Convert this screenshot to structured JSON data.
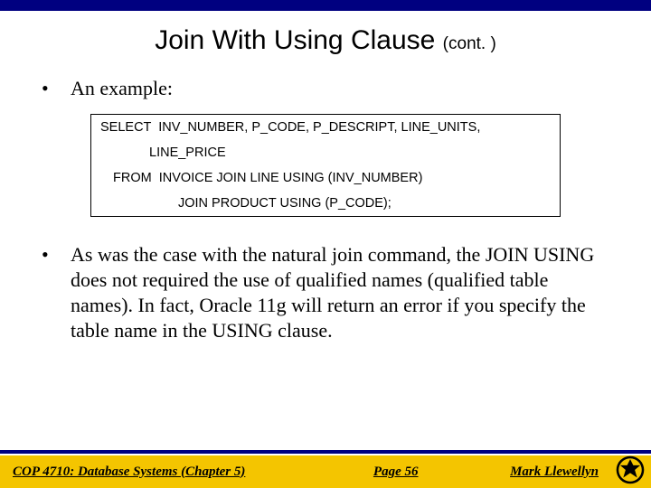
{
  "title_main": "Join With Using Clause ",
  "title_cont": "(cont. )",
  "bullets": {
    "b1": "An example:",
    "b2": "As was the case with the natural join command, the JOIN USING does not required the use of qualified names (qualified table names).  In fact, Oracle 11g will return an error if you specify the table name in the USING clause."
  },
  "sql": {
    "l1": "SELECT  INV_NUMBER, P_CODE, P_DESCRIPT, LINE_UNITS,",
    "l2": "LINE_PRICE",
    "l3": "FROM  INVOICE JOIN LINE USING (INV_NUMBER)",
    "l4": "JOIN PRODUCT USING (P_CODE);"
  },
  "footer": {
    "left": "COP 4710: Database Systems  (Chapter 5)",
    "center": "Page 56",
    "right": "Mark Llewellyn"
  },
  "colors": {
    "navy": "#000080",
    "gold": "#f4c500"
  }
}
